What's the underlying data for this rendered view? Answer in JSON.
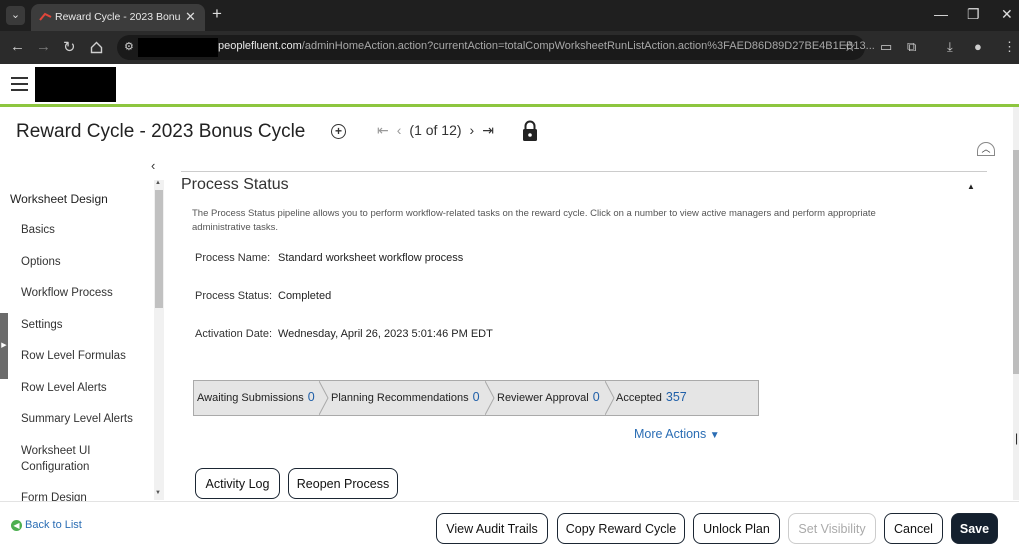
{
  "browser": {
    "tab_title": "Reward Cycle - 2023 Bonus Cycle",
    "url_domain": "peoplefluent.com",
    "url_rest": "/adminHomeAction.action?currentAction=totalCompWorksheetRunListAction.action%3FAED86D89D27BE4B1EB13..."
  },
  "header": {
    "title": "Reward Cycle - 2023 Bonus Cycle",
    "pager_text": "(1 of 12)"
  },
  "sidebar": {
    "heading": "Worksheet Design",
    "items": [
      {
        "label": "Basics"
      },
      {
        "label": "Options"
      },
      {
        "label": "Workflow Process"
      },
      {
        "label": "Settings"
      },
      {
        "label": "Row Level Formulas"
      },
      {
        "label": "Row Level Alerts"
      },
      {
        "label": "Summary Level Alerts"
      },
      {
        "label": "Worksheet UI Configuration"
      },
      {
        "label": "Form Design"
      }
    ]
  },
  "main": {
    "section_title": "Process Status",
    "description": "The Process Status pipeline allows you to perform workflow-related tasks on the reward cycle. Click on a number to view active managers and perform appropriate administrative tasks.",
    "process_name_label": "Process Name:",
    "process_name_value": "Standard worksheet workflow process",
    "process_status_label": "Process Status:",
    "process_status_value": "Completed",
    "activation_date_label": "Activation Date:",
    "activation_date_value": "Wednesday, April 26, 2023 5:01:46 PM EDT",
    "pipeline": [
      {
        "label": "Awaiting Submissions",
        "count": "0"
      },
      {
        "label": "Planning Recommendations",
        "count": "0"
      },
      {
        "label": "Reviewer Approval",
        "count": "0"
      },
      {
        "label": "Accepted",
        "count": "357"
      }
    ],
    "more_actions": "More Actions",
    "activity_log": "Activity Log",
    "reopen_process": "Reopen Process"
  },
  "footer": {
    "back_link": "Back to List",
    "view_audit_trails": "View Audit Trails",
    "copy_reward_cycle": "Copy Reward Cycle",
    "unlock_plan": "Unlock Plan",
    "set_visibility": "Set Visibility",
    "cancel": "Cancel",
    "save": "Save"
  },
  "colors": {
    "accent_green": "#8dc63f",
    "link_blue": "#2a6db4",
    "primary_button": "#14202e"
  }
}
